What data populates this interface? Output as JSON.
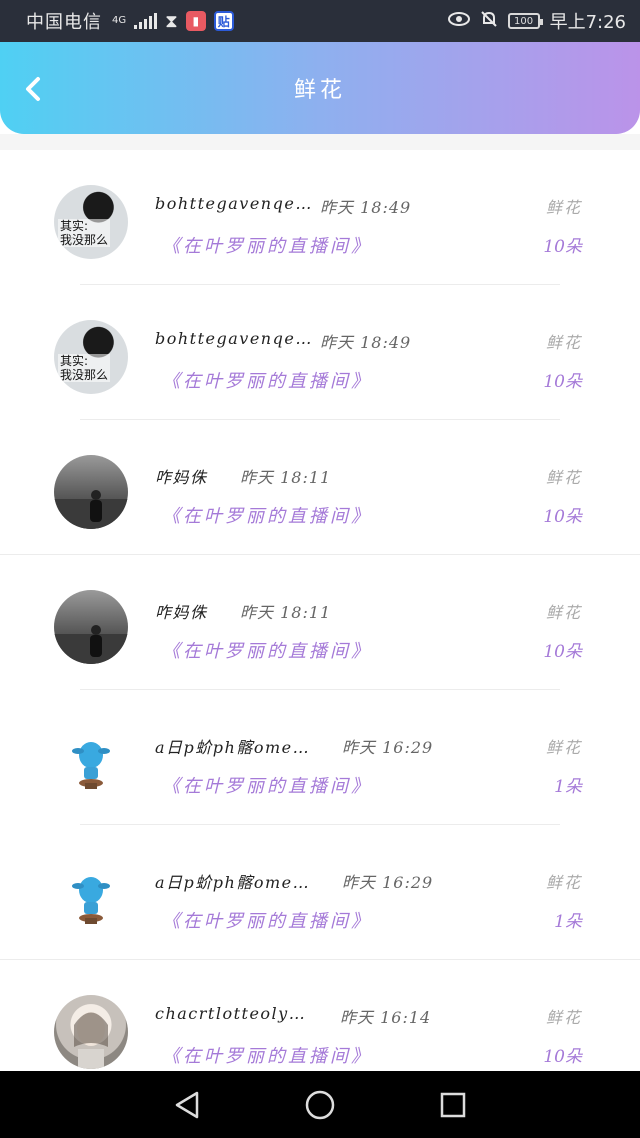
{
  "status_bar": {
    "carrier": "中国电信",
    "network": "4G",
    "clock": "早上7:26",
    "battery": "100",
    "app_badge_2": "贴",
    "colors": {
      "background": "#2a2f3a"
    }
  },
  "header": {
    "title": "鲜花",
    "colors": {
      "gradient_start": "#4fd0f3",
      "gradient_end": "#bb93e9"
    }
  },
  "items": [
    {
      "username": "bohttegavenqetara",
      "time": "昨天 18:49",
      "gift": "鲜花",
      "room": "《在叶罗丽的直播间》",
      "count": "10朵",
      "avatar_caption": "其实:\n我没那么"
    },
    {
      "username": "bohttegavenqetara",
      "time": "昨天 18:49",
      "gift": "鲜花",
      "room": "《在叶罗丽的直播间》",
      "count": "10朵",
      "avatar_caption": "其实:\n我没那么"
    },
    {
      "username": "咋妈侏",
      "time": "昨天 18:11",
      "gift": "鲜花",
      "room": "《在叶罗丽的直播间》",
      "count": "10朵"
    },
    {
      "username": "咋妈侏",
      "time": "昨天 18:11",
      "gift": "鲜花",
      "room": "《在叶罗丽的直播间》",
      "count": "10朵"
    },
    {
      "username": "a日p蚧ph髂ome…",
      "time": "昨天 16:29",
      "gift": "鲜花",
      "room": "《在叶罗丽的直播间》",
      "count": "1朵"
    },
    {
      "username": "a日p蚧ph髂ome…",
      "time": "昨天 16:29",
      "gift": "鲜花",
      "room": "《在叶罗丽的直播间》",
      "count": "1朵"
    },
    {
      "username": "chacrtlotteolyympioa",
      "time": "昨天 16:14",
      "gift": "鲜花",
      "room": "《在叶罗丽的直播间》",
      "count": "10朵"
    }
  ],
  "colors": {
    "accent_purple": "#a57ad8",
    "muted": "#aaaaaa"
  }
}
